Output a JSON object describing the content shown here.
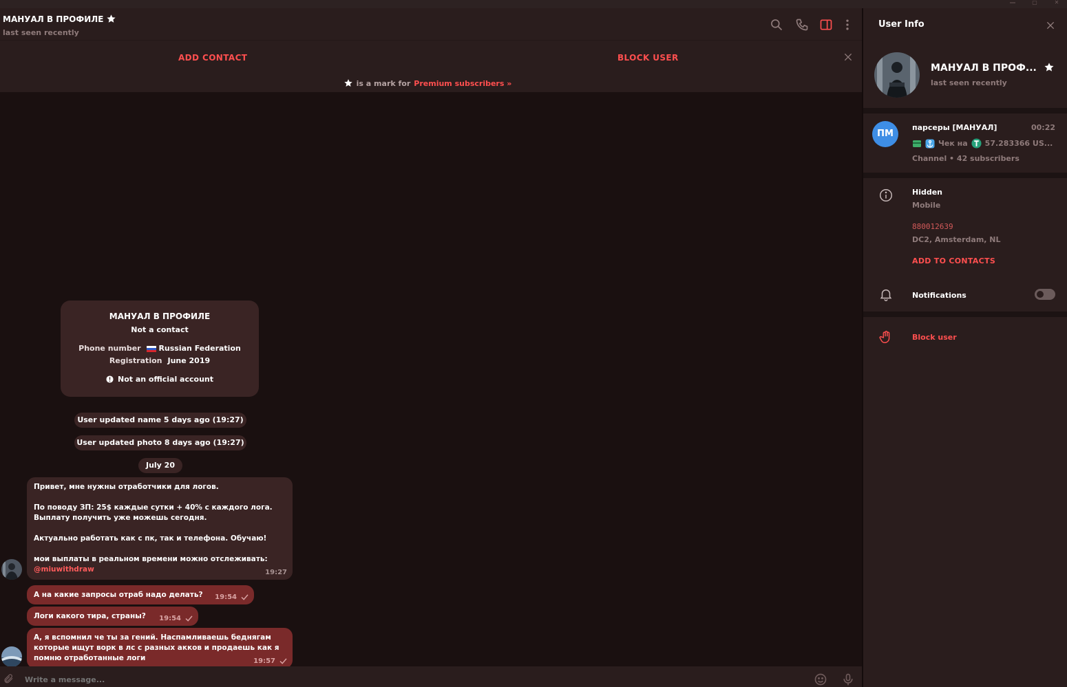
{
  "colors": {
    "accent": "#ff4f4f",
    "outgoing_bubble": "#7a2a2a",
    "incoming_bubble": "#3a2424",
    "channel_avatar": "#3e8ee6"
  },
  "header": {
    "name": "МАНУАЛ В ПРОФИЛЕ",
    "status": "last seen recently",
    "icons": [
      "search-icon",
      "phone-icon",
      "sidebar-toggle-icon",
      "more-vertical-icon"
    ]
  },
  "actions": {
    "add_contact": "ADD CONTACT",
    "block_user": "BLOCK USER",
    "premium_text": "is a mark for",
    "premium_link": "Premium subscribers »"
  },
  "info_card": {
    "title": "МАНУАЛ В ПРОФИЛЕ",
    "subtitle": "Not a contact",
    "phone_label": "Phone number",
    "phone_value": "Russian Federation",
    "reg_label": "Registration",
    "reg_value": "June 2019",
    "note": "Not an official account"
  },
  "service": {
    "name_update": "User updated name 5 days ago (19:27)",
    "photo_update": "User updated photo 8 days ago (19:27)",
    "date": "July 20"
  },
  "messages": [
    {
      "lines": [
        "Привет, мне нужны отработчики для логов.",
        "",
        "По поводу ЗП: 25$ каждые сутки + 40% с каждого лога.",
        "Выплату получить уже можешь сегодня.",
        "",
        "Актуально работать как с пк, так и телефона. Обучаю!",
        "",
        "мои выплаты в реальном времени можно отслеживать:"
      ],
      "mention": "@miuwithdraw",
      "time": "19:27"
    },
    {
      "text": "А на какие запросы отраб надо делать?",
      "time": "19:54"
    },
    {
      "text": "Логи какого тира, страны?",
      "time": "19:54"
    },
    {
      "lines": [
        "А, я вспомнил че ты за гений. Наспамливаешь беднягам",
        "которые ищут ворк в лс с разных акков и продаешь как я",
        "помню отработанные логи"
      ],
      "time": "19:57"
    }
  ],
  "composer": {
    "placeholder": "Write a message..."
  },
  "user_info": {
    "title": "User Info",
    "name": "МАНУАЛ В ПРОФ...",
    "status": "last seen recently",
    "channel": {
      "initials": "ПМ",
      "name": "парсеры [МАНУАЛ]",
      "time": "00:22",
      "message": "Чек на",
      "amount": "57.283366 US...",
      "meta": "Channel • 42 subscribers"
    },
    "bio_value": "Hidden",
    "bio_label": "Mobile",
    "id_value": "880012639",
    "dc": "DC2, Amsterdam, NL",
    "add_contacts": "ADD TO CONTACTS",
    "notifications": "Notifications",
    "notifications_on": false,
    "block_user": "Block user"
  }
}
